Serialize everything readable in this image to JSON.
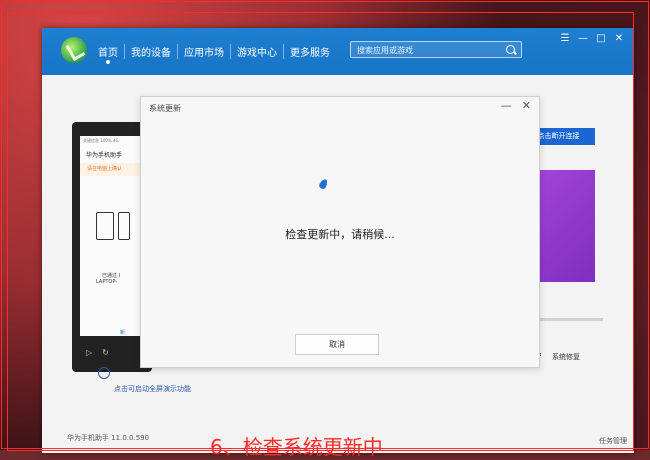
{
  "app": {
    "nav": [
      {
        "label": "首页",
        "active": true
      },
      {
        "label": "我的设备"
      },
      {
        "label": "应用市场"
      },
      {
        "label": "游戏中心"
      },
      {
        "label": "更多服务"
      }
    ],
    "search_placeholder": "搜索应用或游戏",
    "window_controls": [
      "☰",
      "—",
      "□",
      "✕"
    ]
  },
  "phone": {
    "status": "关键信息 100% 4G",
    "title": "华为手机助手",
    "notice": "请在电脑上确认",
    "line1": "已通过 I",
    "line2": "LAPTOP-",
    "link": "新"
  },
  "hint": "点击可启动全屏演示功能",
  "right": {
    "connect_button": "点击断开连接",
    "repair_label": "系统修复"
  },
  "footer": {
    "version": "华为手机助手 11.0.0.590",
    "task_manager": "任务管理"
  },
  "dialog": {
    "title": "系统更新",
    "message": "检查更新中，请稍候...",
    "cancel": "取消",
    "controls": [
      "—",
      "✕"
    ]
  },
  "caption": "6、检查系统更新中"
}
